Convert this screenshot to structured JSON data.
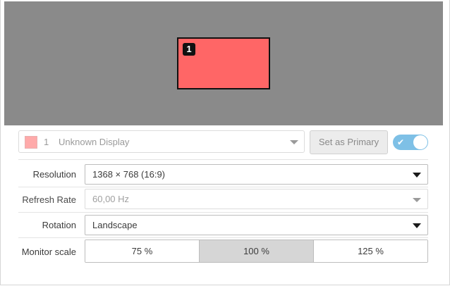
{
  "preview": {
    "monitor_number": "1",
    "monitor_color": "#ff6666"
  },
  "display": {
    "number": "1",
    "name": "Unknown Display",
    "swatch_color": "#ffaaaa",
    "set_primary_label": "Set as Primary",
    "enabled": true,
    "toggle_check": "✔"
  },
  "settings": {
    "resolution": {
      "label": "Resolution",
      "value": "1368 × 768 (16:9)"
    },
    "refresh_rate": {
      "label": "Refresh Rate",
      "value": "60,00 Hz"
    },
    "rotation": {
      "label": "Rotation",
      "value": "Landscape"
    },
    "monitor_scale": {
      "label": "Monitor scale",
      "options": [
        "75 %",
        "100 %",
        "125 %"
      ],
      "selected": "100 %"
    }
  }
}
